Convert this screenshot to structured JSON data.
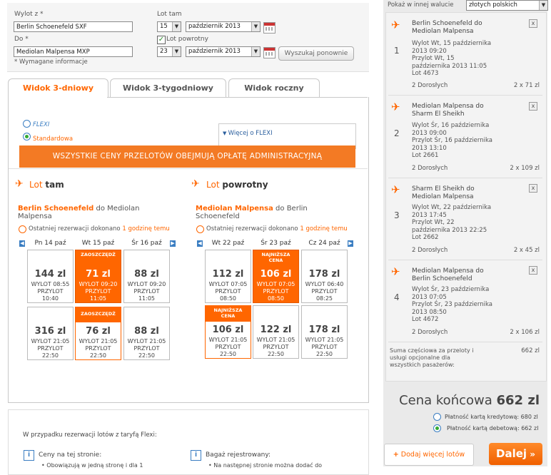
{
  "form": {
    "from_label": "Wylot z *",
    "from_value": "Berlin Schoenefeld SXF",
    "to_label": "Do *",
    "to_value": "Mediolan Malpensa MXP",
    "required_note": "* Wymagane informacje",
    "outbound_label": "Lot tam",
    "outbound_day": "15",
    "outbound_month": "październik 2013",
    "return_checkbox_label": "Lot powrotny",
    "return_day": "23",
    "return_month": "październik 2013",
    "search_again": "Wyszukaj ponownie"
  },
  "tabs": [
    "Widok 3-dniowy",
    "Widok 3-tygodniowy",
    "Widok roczny"
  ],
  "fares": {
    "flexi": "FLEXI",
    "standard": "Standardowa",
    "more_flexi": "Więcej o FLEXI",
    "banner": "WSZYSTKIE CENY PRZELOTÓW OBEJMUJĄ OPŁATĘ ADMINISTRACYJNĄ"
  },
  "outbound": {
    "title_a": "Lot",
    "title_b": "tam",
    "route_from": "Berlin Schoenefeld",
    "route_mid": "do",
    "route_to": "Mediolan Malpensa",
    "recent_a": "Ostatniej rezerwacji dokonano",
    "recent_b": "1 godzinę temu",
    "days": [
      "Pn 14 paź",
      "Wt 15 paź",
      "Śr 16 paź"
    ],
    "row1": [
      {
        "price": "144 zl",
        "dep": "WYLOT 08:55",
        "arr": "PRZYLOT",
        "arrt": "10:40",
        "tag": ""
      },
      {
        "price": "71 zl",
        "dep": "WYLOT 09:20",
        "arr": "PRZYLOT",
        "arrt": "11:05",
        "tag": "ZAOSZCZĘDŹ"
      },
      {
        "price": "88 zl",
        "dep": "WYLOT 09:20",
        "arr": "PRZYLOT",
        "arrt": "11:05",
        "tag": ""
      }
    ],
    "row2": [
      {
        "price": "316 zl",
        "dep": "WYLOT 21:05",
        "arr": "PRZYLOT",
        "arrt": "22:50",
        "tag": ""
      },
      {
        "price": "76 zl",
        "dep": "WYLOT 21:05",
        "arr": "PRZYLOT",
        "arrt": "22:50",
        "tag": "ZAOSZCZĘDŹ"
      },
      {
        "price": "88 zl",
        "dep": "WYLOT 21:05",
        "arr": "PRZYLOT",
        "arrt": "22:50",
        "tag": ""
      }
    ]
  },
  "return": {
    "title_a": "Lot",
    "title_b": "powrotny",
    "route_from": "Mediolan Malpensa",
    "route_mid": "do Berlin",
    "route_to": "Schoenefeld",
    "recent_a": "Ostatniej rezerwacji dokonano",
    "recent_b": "1 godzinę temu",
    "days": [
      "Wt 22 paź",
      "Śr 23 paź",
      "Cz 24 paź"
    ],
    "row1": [
      {
        "price": "112 zl",
        "dep": "WYLOT 07:05",
        "arr": "PRZYLOT",
        "arrt": "08:50",
        "tag": ""
      },
      {
        "price": "106 zl",
        "dep": "WYLOT 07:05",
        "arr": "PRZYLOT",
        "arrt": "08:50",
        "tag": "NAJNIŻSZA CENA"
      },
      {
        "price": "178 zl",
        "dep": "WYLOT 06:40",
        "arr": "PRZYLOT",
        "arrt": "08:25",
        "tag": ""
      }
    ],
    "row2": [
      {
        "price": "106 zl",
        "dep": "WYLOT 21:05",
        "arr": "PRZYLOT",
        "arrt": "22:50",
        "tag": "NAJNIŻSZA CENA"
      },
      {
        "price": "122 zl",
        "dep": "WYLOT 21:05",
        "arr": "PRZYLOT",
        "arrt": "22:50",
        "tag": ""
      },
      {
        "price": "178 zl",
        "dep": "WYLOT 21:05",
        "arr": "PRZYLOT",
        "arrt": "22:50",
        "tag": ""
      }
    ]
  },
  "info": {
    "intro": "W przypadku rezerwacji lotów z taryfą Flexi:",
    "left_title": "Ceny na tej stronie:",
    "left_bullet": "Obowiązują w jedną stronę i dla 1",
    "right_title": "Bagaż rejestrowany:",
    "right_bullet": "Na następnej stronie można dodać do"
  },
  "summary": {
    "currency_label": "Pokaż w innej walucie",
    "currency_value": "złotych polskich",
    "items": [
      {
        "num": "1",
        "title1": "Berlin Schoenefeld do",
        "title2": "Mediolan Malpensa",
        "l1": "Wylot Wt, 15 października",
        "l2": "2013 09:20",
        "l3": "Przylot Wt, 15",
        "l4": "października 2013 11:05",
        "flight": "Lot 4673",
        "pax": "2 Dorosłych",
        "price": "2 x 71 zl"
      },
      {
        "num": "2",
        "title1": "Mediolan Malpensa do",
        "title2": "Sharm El Sheikh",
        "l1": "Wylot Śr, 16 października",
        "l2": "2013 09:00",
        "l3": "Przylot Śr, 16 października",
        "l4": "2013 13:10",
        "flight": "Lot 2661",
        "pax": "2 Dorosłych",
        "price": "2 x 109 zl"
      },
      {
        "num": "3",
        "title1": "Sharm El Sheikh do",
        "title2": "Mediolan Malpensa",
        "l1": "Wylot Wt, 22 października",
        "l2": "2013 17:45",
        "l3": "Przylot Wt, 22",
        "l4": "października 2013 22:25",
        "flight": "Lot 2662",
        "pax": "2 Dorosłych",
        "price": "2 x 45 zl"
      },
      {
        "num": "4",
        "title1": "Mediolan Malpensa do",
        "title2": "Berlin Schoenefeld",
        "l1": "Wylot Śr, 23 października",
        "l2": "2013 07:05",
        "l3": "Przylot Śr, 23 października",
        "l4": "2013 08:50",
        "flight": "Lot 4672",
        "pax": "2 Dorosłych",
        "price": "2 x 106 zl"
      }
    ],
    "subtotal_label": "Suma częściowa za przeloty i usługi opcjonalne dla wszystkich pasażerów:",
    "subtotal_value": "662 zl",
    "final_label": "Cena końcowa",
    "final_value": "662 zl",
    "pay_credit": "Płatność kartą kredytową: 680 zl",
    "pay_debit": "Płatność kartą debetową: 662 zl",
    "add_more": "Dodaj więcej lotów",
    "next": "Dalej"
  }
}
